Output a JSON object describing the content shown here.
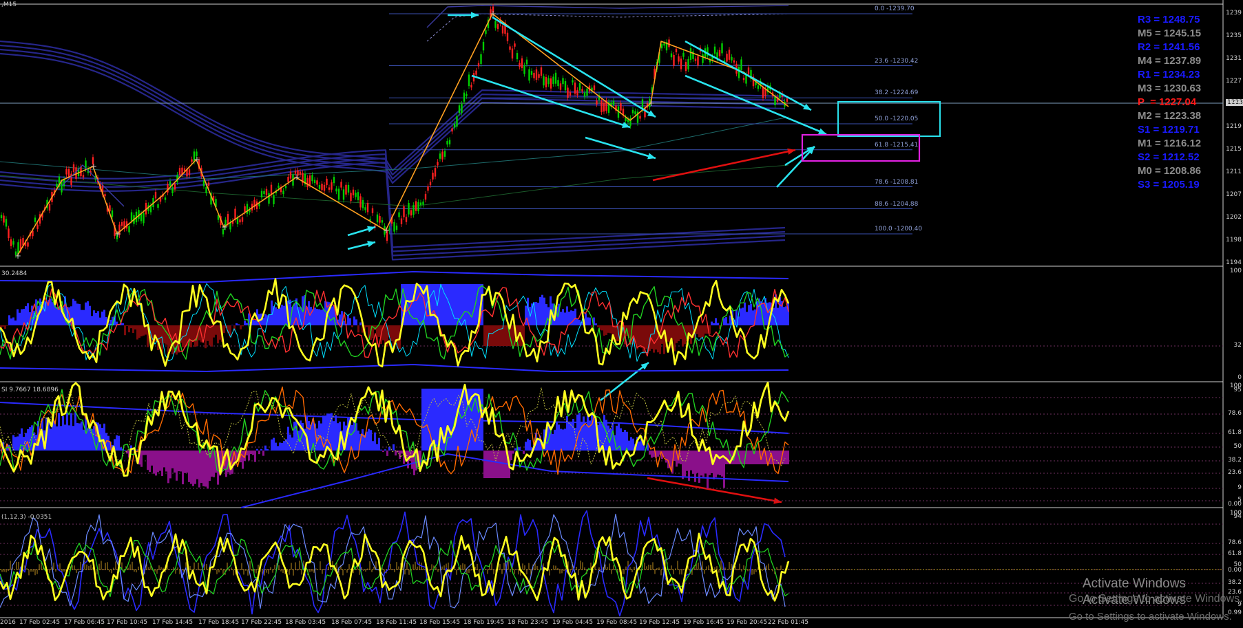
{
  "chart": {
    "title": ",M15",
    "current_price_tag": "1223",
    "price_axis": [
      "1239",
      "1235",
      "1231",
      "1227",
      "1223",
      "1219",
      "1215",
      "1211",
      "1207",
      "1202",
      "1198",
      "1194"
    ],
    "fib_levels": [
      "0.0 -1239.70",
      "23.6 -1230.42",
      "38.2 -1224.69",
      "50.0 -1220.05",
      "61.8 -1215.41",
      "78.6 -1208.81",
      "88.6 -1204.88",
      "100.0 -1200.40"
    ]
  },
  "pivots": [
    {
      "label": "R3 = 1248.75",
      "color": "#1a1aff"
    },
    {
      "label": "M5 = 1245.15",
      "color": "#8c8c8c"
    },
    {
      "label": "R2 = 1241.56",
      "color": "#1a1aff"
    },
    {
      "label": "M4 = 1237.89",
      "color": "#8c8c8c"
    },
    {
      "label": "R1 = 1234.23",
      "color": "#1a1aff"
    },
    {
      "label": "M3 = 1230.63",
      "color": "#8c8c8c"
    },
    {
      "label": "P  = 1227.04",
      "color": "#ff1a1a"
    },
    {
      "label": "M2 = 1223.38",
      "color": "#8c8c8c"
    },
    {
      "label": "S1 = 1219.71",
      "color": "#1a1aff"
    },
    {
      "label": "M1 = 1216.12",
      "color": "#8c8c8c"
    },
    {
      "label": "S2 = 1212.52",
      "color": "#1a1aff"
    },
    {
      "label": "M0 = 1208.86",
      "color": "#8c8c8c"
    },
    {
      "label": "S3 = 1205.19",
      "color": "#1a1aff"
    }
  ],
  "panes": {
    "osc1": {
      "label": "30.2484",
      "ticks": [
        "100",
        "32",
        "0"
      ]
    },
    "osc2": {
      "label": "SI 9.7667 18.6896",
      "ticks": [
        "100",
        "95",
        "78.6",
        "61.8",
        "50",
        "38.2",
        "23.6",
        "9",
        "5",
        "0.00"
      ]
    },
    "osc3": {
      "label": "(1,12,3) -0.0351",
      "ticks": [
        "100",
        "94",
        "78.6",
        "61.8",
        "50",
        "0.00",
        "38.2",
        "23.6",
        "9",
        "0.99"
      ]
    }
  },
  "time_axis": [
    "2016",
    "17 Feb 02:45",
    "17 Feb 06:45",
    "17 Feb 10:45",
    "17 Feb 14:45",
    "17 Feb 18:45",
    "17 Feb 22:45",
    "18 Feb 03:45",
    "18 Feb 07:45",
    "18 Feb 11:45",
    "18 Feb 15:45",
    "18 Feb 19:45",
    "18 Feb 23:45",
    "19 Feb 04:45",
    "19 Feb 08:45",
    "19 Feb 12:45",
    "19 Feb 16:45",
    "19 Feb 20:45",
    "22 Feb 01:45"
  ],
  "watermark": {
    "title": "Activate Windows",
    "subtitle": "Go to Settings to activate Windows."
  },
  "colors": {
    "bull": "#00d000",
    "bear": "#ff2020",
    "zigzag": "#ffa020",
    "annot": "#29e3ee",
    "divergence": "#e01010",
    "magenta": "#e020e0",
    "band": "#1c1c78"
  }
}
